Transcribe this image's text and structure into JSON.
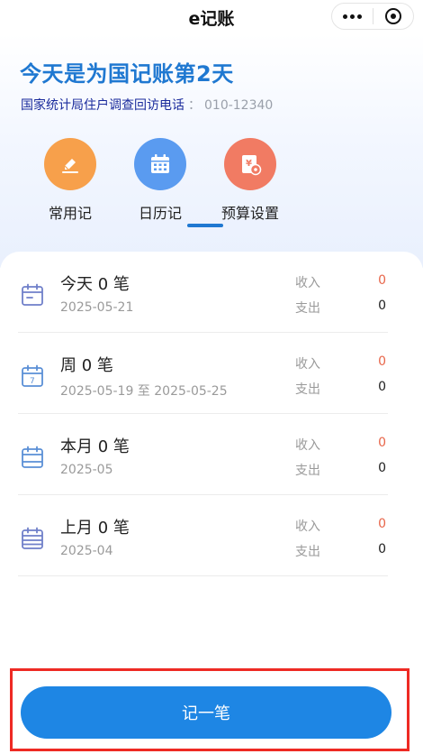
{
  "nav": {
    "title": "e记账"
  },
  "header": {
    "headline": "今天是为国记账第2天",
    "hotline_label": "国家统计局住户调查回访电话",
    "hotline_colon": "：",
    "hotline_number": "010-12340"
  },
  "modes": [
    {
      "label": "常用记",
      "icon": "pen-icon",
      "color": "#f7a04b"
    },
    {
      "label": "日历记",
      "icon": "calendar-icon",
      "color": "#5a9bf0"
    },
    {
      "label": "预算设置",
      "icon": "budget-icon",
      "color": "#f17b63"
    }
  ],
  "active_mode_index": 2,
  "summary": [
    {
      "title": "今天 0 笔",
      "date": "2025-05-21",
      "income_label": "收入",
      "income_value": "0",
      "expense_label": "支出",
      "expense_value": "0"
    },
    {
      "title": "周 0 笔",
      "date": "2025-05-19 至 2025-05-25",
      "income_label": "收入",
      "income_value": "0",
      "expense_label": "支出",
      "expense_value": "0"
    },
    {
      "title": "本月 0 笔",
      "date": "2025-05",
      "income_label": "收入",
      "income_value": "0",
      "expense_label": "支出",
      "expense_value": "0"
    },
    {
      "title": "上月 0 笔",
      "date": "2025-04",
      "income_label": "收入",
      "income_value": "0",
      "expense_label": "支出",
      "expense_value": "0"
    }
  ],
  "colors": {
    "accent": "#1e86e4",
    "income_value": "#e8664a",
    "expense_value": "#222222",
    "icon_stroke": "#6f7fc9",
    "highlight_frame": "#ee2a24"
  },
  "cta": {
    "label": "记一笔"
  }
}
